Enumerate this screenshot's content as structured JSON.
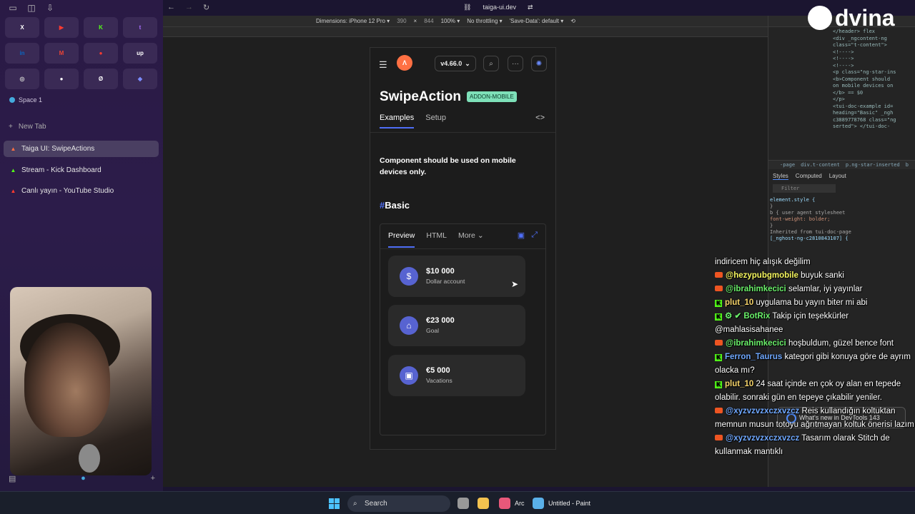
{
  "sidebar": {
    "favorites": [
      {
        "icon": "x-icon",
        "glyph": "X",
        "color": "#ffffff"
      },
      {
        "icon": "youtube-icon",
        "glyph": "▶",
        "color": "#ff3b30"
      },
      {
        "icon": "kick-icon",
        "glyph": "K",
        "color": "#53fc18"
      },
      {
        "icon": "twitch-icon",
        "glyph": "t",
        "color": "#a970ff"
      },
      {
        "icon": "linkedin-icon",
        "glyph": "in",
        "color": "#0a66c2"
      },
      {
        "icon": "gmail-icon",
        "glyph": "M",
        "color": "#ea4335"
      },
      {
        "icon": "youtube-music-icon",
        "glyph": "●",
        "color": "#ff3b30"
      },
      {
        "icon": "upwork-icon",
        "glyph": "up",
        "color": "#ffffff"
      },
      {
        "icon": "globe-icon",
        "glyph": "◎",
        "color": "#cccccc"
      },
      {
        "icon": "dot-icon",
        "glyph": "●",
        "color": "#ffffff"
      },
      {
        "icon": "sync-icon",
        "glyph": "Ø",
        "color": "#ffffff"
      },
      {
        "icon": "linear-icon",
        "glyph": "◆",
        "color": "#7b8cff"
      }
    ],
    "space_label": "Space 1",
    "new_tab_label": "New Tab",
    "tabs": [
      {
        "label": "Taiga UI: SwipeActions",
        "icon": "taiga-icon",
        "color": "#ff7043",
        "active": true
      },
      {
        "label": "Stream - Kick Dashboard",
        "icon": "kick-icon",
        "color": "#53fc18",
        "active": false
      },
      {
        "label": "Canlı yayın - YouTube Studio",
        "icon": "youtube-icon",
        "color": "#ff3b30",
        "active": false
      }
    ]
  },
  "browser": {
    "url": "taiga-ui.dev",
    "devbar": {
      "dimensions": "Dimensions: iPhone 12 Pro ▾",
      "width": "390",
      "height": "844",
      "zoom": "100% ▾",
      "throttle": "No throttling ▾",
      "save_data": "'Save-Data': default ▾"
    }
  },
  "page": {
    "version": "v4.66.0",
    "title": "SwipeAction",
    "badge": "ADDON-MOBILE",
    "tabs": [
      "Examples",
      "Setup"
    ],
    "note": "Component should be used on mobile devices only.",
    "section_hash": "#",
    "section": "Basic",
    "demo_tabs": [
      "Preview",
      "HTML",
      "More"
    ],
    "cards": [
      {
        "amount": "$10 000",
        "label": "Dollar account",
        "icon": "dollar-icon",
        "glyph": "$"
      },
      {
        "amount": "€23 000",
        "label": "Goal",
        "icon": "gift-icon",
        "glyph": "⌂"
      },
      {
        "amount": "€5 000",
        "label": "Vacations",
        "icon": "suitcase-icon",
        "glyph": "▣"
      }
    ]
  },
  "devtools": {
    "dom_lines": [
      "</header> flex",
      "<div _ngcontent-ng",
      "class=\"t-content\">",
      "<!---->",
      "<!---->",
      "<!---->",
      "<p class=\"ng-star-ins",
      "<b>Component should",
      "on mobile devices on",
      "</b> == $0",
      "</p>",
      "<tui-doc-example id=",
      "heading=\"Basic\" _ngh",
      "c3889778768 class=\"ng",
      "serted\"> </tui-doc-"
    ],
    "crumbs": [
      "-page",
      "div.t-content",
      "p.ng-star-inserted",
      "b"
    ],
    "style_tabs": [
      "Styles",
      "Computed",
      "Layout"
    ],
    "filter_placeholder": "Filter",
    "styles_lines": [
      {
        "t": "element.style {",
        "c": "p"
      },
      {
        "t": "}",
        "c": ""
      },
      {
        "t": "b {       user agent stylesheet",
        "c": ""
      },
      {
        "t": "  font-weight: bolder;",
        "c": "v"
      },
      {
        "t": "}",
        "c": ""
      },
      {
        "t": "Inherited from tui-doc-page",
        "c": ""
      },
      {
        "t": "[_nghost-ng-c2810843107] {",
        "c": "p"
      }
    ],
    "popup": "What's new in DevTools 143"
  },
  "overlay": {
    "brand": "dvina"
  },
  "chat": [
    {
      "src": "",
      "user": "",
      "cls": "",
      "text": "indiricem hiç alışık değilim"
    },
    {
      "src": "yt",
      "user": "@hezypubgmobile",
      "cls": "u1",
      "text": "buyuk sanki"
    },
    {
      "src": "yt",
      "user": "@ibrahimkecici",
      "cls": "u2",
      "text": "selamlar, iyi yayınlar"
    },
    {
      "src": "kick",
      "user": "plut_10",
      "cls": "u4",
      "text": "uygulama bu yayın biter mi abi"
    },
    {
      "src": "kick",
      "user": "⚙ ✔ BotRix",
      "cls": "u2",
      "text": "Takip için teşekkürler @mahlasisahanee"
    },
    {
      "src": "yt",
      "user": "@ibrahimkecici",
      "cls": "u2",
      "text": "hoşbuldum, güzel bence font"
    },
    {
      "src": "kick",
      "user": "Ferron_Taurus",
      "cls": "u3",
      "text": "kategori gibi konuya göre de ayrım olacka mı?"
    },
    {
      "src": "kick",
      "user": "plut_10",
      "cls": "u4",
      "text": "24 saat içinde en çok oy alan en tepede olabilir. sonraki gün en tepeye çıkabilir yeniler."
    },
    {
      "src": "yt",
      "user": "@xyzvzvzxczxvzcz",
      "cls": "u3",
      "text": "Reis kullandığın koltuktan memnun musun totoyu ağrıtmayan koltuk önerisi lazım"
    },
    {
      "src": "yt",
      "user": "@xyzvzvzxczxvzcz",
      "cls": "u3",
      "text": "Tasarım olarak Stitch de kullanmak mantıklı"
    }
  ],
  "taskbar": {
    "search_label": "Search",
    "apps": [
      {
        "label": "Arc",
        "icon": "arc-icon",
        "color": "#e8587a"
      },
      {
        "label": "Untitled - Paint",
        "icon": "paint-icon",
        "color": "#5ab0e8"
      }
    ]
  }
}
